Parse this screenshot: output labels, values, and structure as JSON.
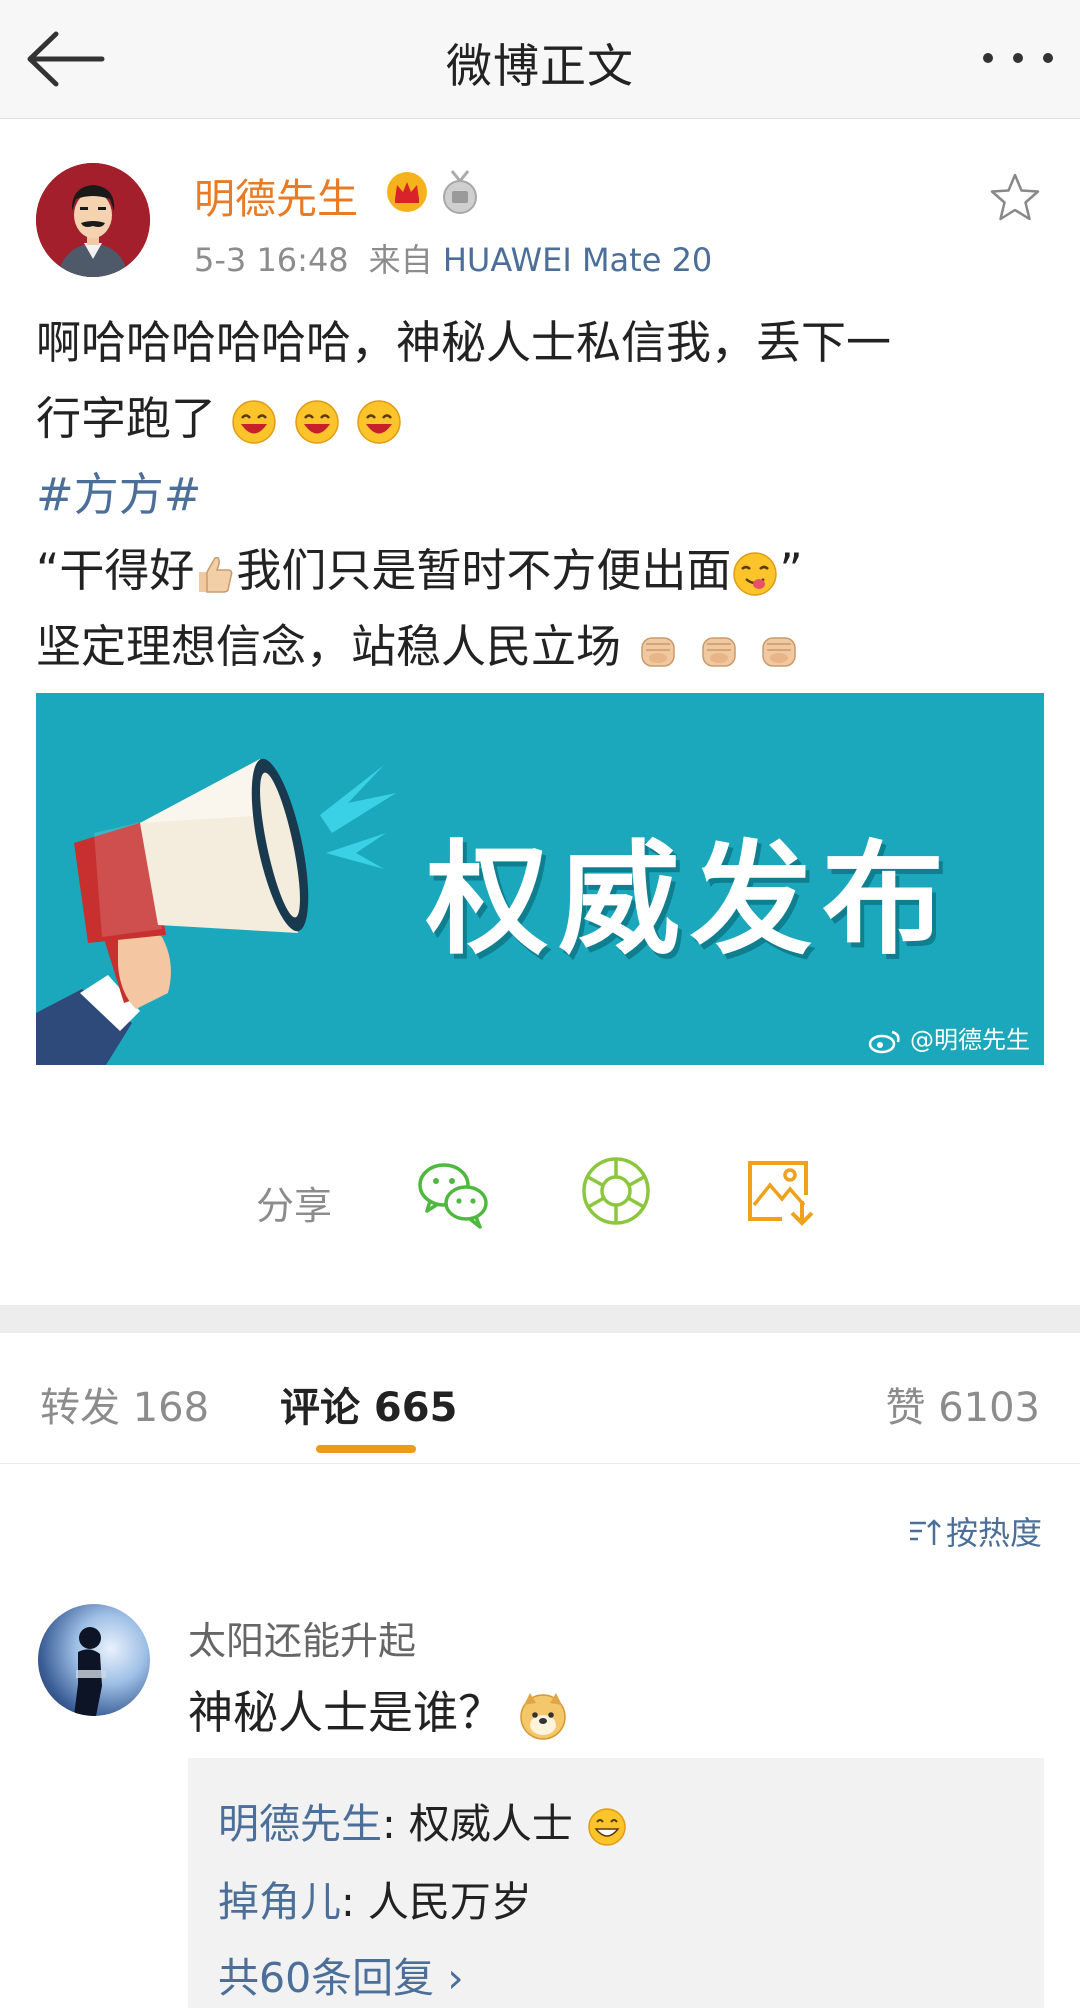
{
  "header": {
    "title": "微博正文",
    "back_icon": "arrow-left-icon",
    "more_icon": "more-dots-icon"
  },
  "post": {
    "author": "明德先生",
    "author_color": "#e87b24",
    "badges": [
      "crown-icon",
      "medal-icon"
    ],
    "time": "5-3 16:48",
    "source_prefix": "来自",
    "source": "HUAWEI Mate 20",
    "text_line1": "啊哈哈哈哈哈哈，神秘人士私信我，丢下一",
    "text_line2": "行字跑了",
    "hashtag": "#方方#",
    "quote_open": "“干得好",
    "quote_mid": "我们只是暂时不方便出面",
    "quote_close": "”",
    "text_line5": "坚定理想信念，站稳人民立场",
    "image": {
      "title": "权威发布",
      "watermark": "@明德先生",
      "bg_color": "#1ba8bc"
    }
  },
  "share": {
    "label": "分享",
    "icons": [
      "wechat-icon",
      "moments-icon",
      "save-image-icon"
    ]
  },
  "tabs": {
    "repost": "转发 168",
    "comments": "评论 665",
    "likes": "赞 6103",
    "active": "comments",
    "accent": "#f09a19"
  },
  "sort": {
    "label": "按热度"
  },
  "comment": {
    "name": "太阳还能升起",
    "text": "神秘人士是谁？",
    "replies": [
      {
        "name": "明德先生",
        "text": "权威人士"
      },
      {
        "name": "掉角儿",
        "text": "人民万岁"
      }
    ],
    "more": "共60条回复 ›"
  },
  "colors": {
    "link": "#4b6f99",
    "muted": "#8c8c8c"
  }
}
